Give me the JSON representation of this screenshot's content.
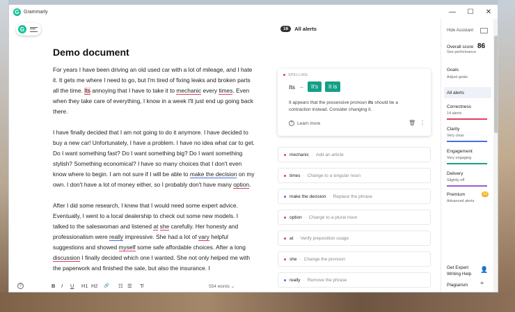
{
  "window": {
    "app_title": "Grammarly",
    "controls": [
      "—",
      "☐",
      "✕"
    ]
  },
  "editor": {
    "doc_title": "Demo document",
    "paragraphs": [
      [
        {
          "t": "For years I have been driving an old used car with a lot of mileage, and I hate it. It gets me where I need to go, but I'm tired of fixing leaks and broken parts all the time. "
        },
        {
          "t": "Its",
          "m": "hl"
        },
        {
          "t": " annoying that I have to take it to "
        },
        {
          "t": "mechanic",
          "m": "u-red"
        },
        {
          "t": " every "
        },
        {
          "t": "times",
          "m": "u-red"
        },
        {
          "t": ". Even when they take care of everything, I know in a week I'll just end up going back there."
        }
      ],
      [
        {
          "t": "I have finally decided that I am not going to do it anymore. I have decided to buy a new car! Unfortunately, I have a problem. I have no idea what car to get. Do I want something fast? Do I want something big? Do I want something stylish? Something economical? I have so many choices that I don't even know where to begin. I am not sure if I will be able to "
        },
        {
          "t": "make the decision",
          "m": "u-blue"
        },
        {
          "t": " on my own. I don't have a lot of money either, so I probably don't have many "
        },
        {
          "t": "option",
          "m": "u-red"
        },
        {
          "t": "."
        }
      ],
      [
        {
          "t": "After I did some research, I knew that I would need some expert advice. Eventually, I went to a local dealership to check out some new models. I talked to the saleswoman and listened "
        },
        {
          "t": "at",
          "m": "u-red"
        },
        {
          "t": " "
        },
        {
          "t": "she",
          "m": "u-red"
        },
        {
          "t": " carefully. Her honesty and professionalism were "
        },
        {
          "t": "really",
          "m": "u-blue"
        },
        {
          "t": " impressive. She had a lot of "
        },
        {
          "t": "vary",
          "m": "u-red"
        },
        {
          "t": " helpful suggestions and showed "
        },
        {
          "t": "myself",
          "m": "u-red"
        },
        {
          "t": " some safe affordable choices. After a long "
        },
        {
          "t": "discussion",
          "m": "u-red"
        },
        {
          "t": " I finally decided which one I wanted. She not only helped me with the paperwork and finished the sale, but also the insurance. I"
        }
      ]
    ],
    "toolbar": {
      "bold": "B",
      "italic": "I",
      "underline": "U",
      "h1": "H1",
      "h2": "H2",
      "link": "🔗",
      "ol": "☷",
      "ul": "☰",
      "clear": "T̸"
    },
    "word_count": "554 words ⌄",
    "help": "?"
  },
  "alerts": {
    "count": "16",
    "title": "All alerts",
    "card": {
      "category": "SPELLING",
      "original": "Its",
      "arrow": "→",
      "suggestions": [
        "It's",
        "It is"
      ],
      "desc_pre": "It appears that the possessive pronoun ",
      "desc_em": "Its",
      "desc_post": " should be a contraction instead. Consider changing it.",
      "learn_more": "Learn more"
    },
    "items": [
      {
        "word": "mechanic",
        "hint": "Add an article",
        "color": "#e0405b"
      },
      {
        "word": "times",
        "hint": "Change to a singular noun",
        "color": "#e0405b"
      },
      {
        "word": "make the decision",
        "hint": "Replace the phrase",
        "color": "#4a6ee0"
      },
      {
        "word": "option",
        "hint": "Change to a plural noun",
        "color": "#e0405b"
      },
      {
        "word": "at",
        "hint": "Verify preposition usage",
        "color": "#e0405b"
      },
      {
        "word": "she",
        "hint": "Change the pronoun",
        "color": "#e0405b"
      },
      {
        "word": "really",
        "hint": "Remove the phrase",
        "color": "#4a6ee0"
      }
    ]
  },
  "panel": {
    "hide_assistant": "Hide Assistant",
    "overall_score_label": "Overall score",
    "overall_score": "86",
    "see_performance": "See performance",
    "goals": "Goals",
    "adjust_goals": "Adjust goals",
    "all_alerts": "All alerts",
    "categories": [
      {
        "name": "Correctness",
        "sub": "14 alerts",
        "color": "#e0405b"
      },
      {
        "name": "Clarity",
        "sub": "Very clear",
        "color": "#4a6ee0"
      },
      {
        "name": "Engagement",
        "sub": "Very engaging",
        "color": "#15a085"
      },
      {
        "name": "Delivery",
        "sub": "Slightly off",
        "color": "#9a5bd0"
      }
    ],
    "premium": "Premium",
    "premium_badge": "10",
    "advanced_alerts": "Advanced alerts",
    "expert_help": "Get Expert Writing Help",
    "plagiarism": "Plagiarism"
  }
}
